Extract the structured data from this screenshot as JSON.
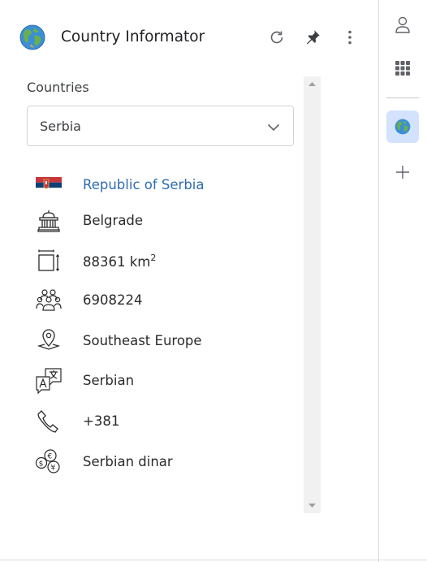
{
  "app": {
    "title": "Country Informator",
    "icon": "globe-icon",
    "header_buttons": [
      "refresh-icon",
      "pin-icon",
      "more-vert-icon"
    ]
  },
  "selector": {
    "label": "Countries",
    "value": "Serbia"
  },
  "info": {
    "official_name": "Republic of Serbia",
    "capital": "Belgrade",
    "area_value": "88361 km",
    "area_unit_sup": "2",
    "population": "6908224",
    "region": "Southeast Europe",
    "language": "Serbian",
    "calling_code": "+381",
    "currency": "Serbian dinar"
  },
  "rail": {
    "items": [
      "profile-icon",
      "apps-grid-icon",
      "globe-icon",
      "add-icon"
    ],
    "active": "globe-icon"
  },
  "colors": {
    "link": "#2f6db0",
    "rail_active_bg": "#d3e3fd",
    "scrollbar_track": "#f1f1f1"
  }
}
